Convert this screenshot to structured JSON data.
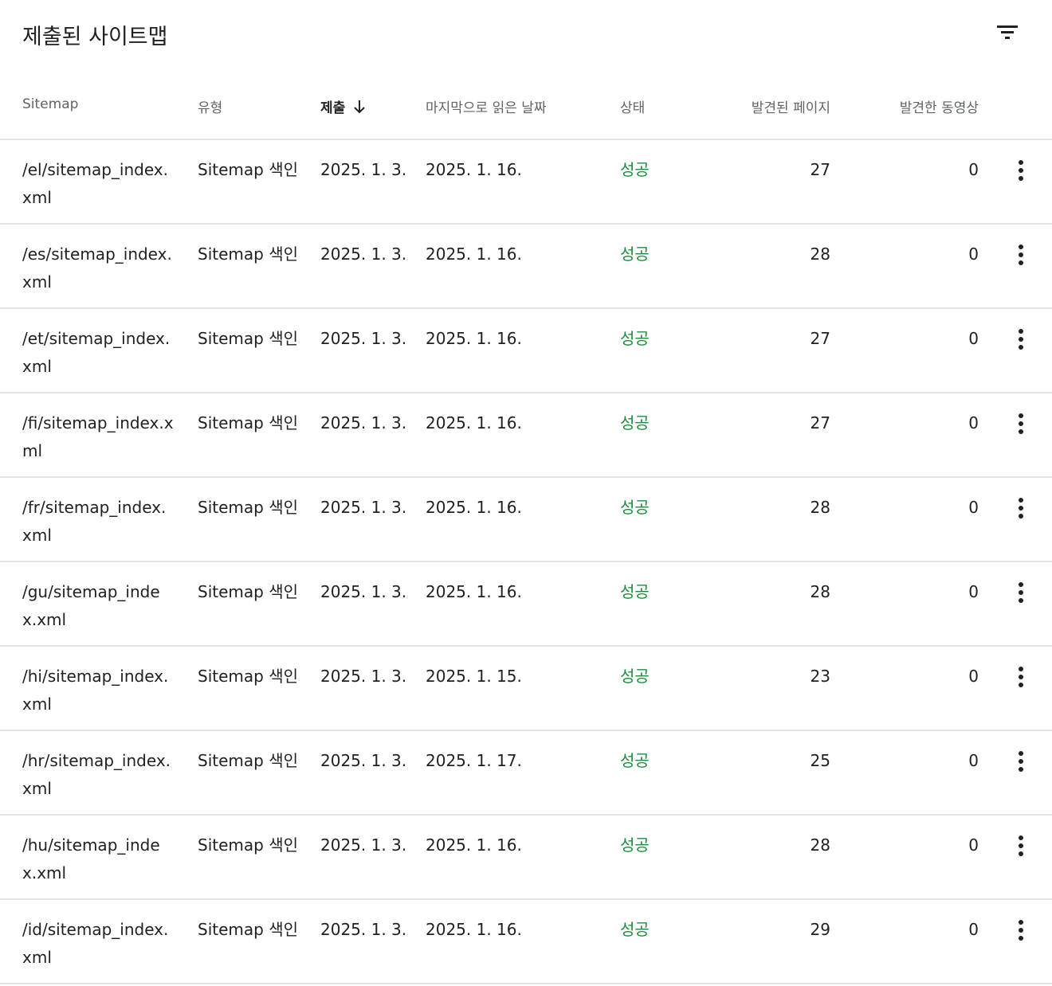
{
  "header": {
    "title": "제출된 사이트맵",
    "filter_icon": "filter-list-icon"
  },
  "columns": [
    {
      "key": "path",
      "label": "Sitemap"
    },
    {
      "key": "type",
      "label": "유형"
    },
    {
      "key": "submitted",
      "label": "제출",
      "sorted": "descending"
    },
    {
      "key": "lastread",
      "label": "마지막으로 읽은 날짜"
    },
    {
      "key": "status",
      "label": "상태"
    },
    {
      "key": "pages",
      "label": "발견된 페이지"
    },
    {
      "key": "videos",
      "label": "발견한 동영상"
    }
  ],
  "status_color": "#1e8e3e",
  "rows": [
    {
      "path": "/el/sitemap_index.xml",
      "type": "Sitemap 색인",
      "submitted": "2025. 1. 3.",
      "lastread": "2025. 1. 16.",
      "status": "성공",
      "pages": "27",
      "videos": "0"
    },
    {
      "path": "/es/sitemap_index.xml",
      "type": "Sitemap 색인",
      "submitted": "2025. 1. 3.",
      "lastread": "2025. 1. 16.",
      "status": "성공",
      "pages": "28",
      "videos": "0"
    },
    {
      "path": "/et/sitemap_index.xml",
      "type": "Sitemap 색인",
      "submitted": "2025. 1. 3.",
      "lastread": "2025. 1. 16.",
      "status": "성공",
      "pages": "27",
      "videos": "0"
    },
    {
      "path": "/fi/sitemap_index.xml",
      "type": "Sitemap 색인",
      "submitted": "2025. 1. 3.",
      "lastread": "2025. 1. 16.",
      "status": "성공",
      "pages": "27",
      "videos": "0"
    },
    {
      "path": "/fr/sitemap_index.xml",
      "type": "Sitemap 색인",
      "submitted": "2025. 1. 3.",
      "lastread": "2025. 1. 16.",
      "status": "성공",
      "pages": "28",
      "videos": "0"
    },
    {
      "path": "/gu/sitemap_index.xml",
      "type": "Sitemap 색인",
      "submitted": "2025. 1. 3.",
      "lastread": "2025. 1. 16.",
      "status": "성공",
      "pages": "28",
      "videos": "0"
    },
    {
      "path": "/hi/sitemap_index.xml",
      "type": "Sitemap 색인",
      "submitted": "2025. 1. 3.",
      "lastread": "2025. 1. 15.",
      "status": "성공",
      "pages": "23",
      "videos": "0"
    },
    {
      "path": "/hr/sitemap_index.xml",
      "type": "Sitemap 색인",
      "submitted": "2025. 1. 3.",
      "lastread": "2025. 1. 17.",
      "status": "성공",
      "pages": "25",
      "videos": "0"
    },
    {
      "path": "/hu/sitemap_index.xml",
      "type": "Sitemap 색인",
      "submitted": "2025. 1. 3.",
      "lastread": "2025. 1. 16.",
      "status": "성공",
      "pages": "28",
      "videos": "0"
    },
    {
      "path": "/id/sitemap_index.xml",
      "type": "Sitemap 색인",
      "submitted": "2025. 1. 3.",
      "lastread": "2025. 1. 16.",
      "status": "성공",
      "pages": "29",
      "videos": "0"
    }
  ]
}
